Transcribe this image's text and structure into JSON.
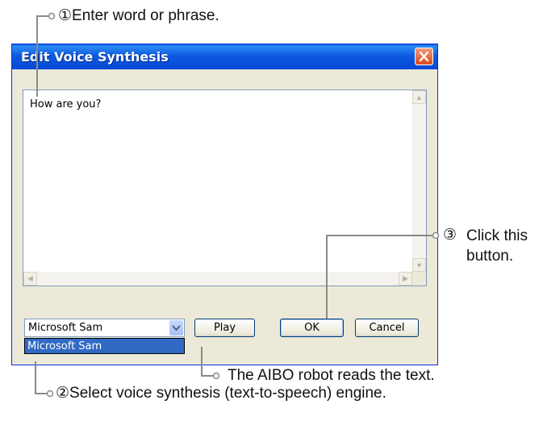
{
  "annotations": {
    "step1": "①Enter word or phrase.",
    "step2": "②Select voice synthesis (text-to-speech) engine.",
    "step3_number": "③",
    "step3_text": "Click this button.",
    "play_note": "The AIBO robot reads the text."
  },
  "dialog": {
    "title": "Edit Voice Synthesis",
    "text_value": "How are you?",
    "engine_selected": "Microsoft Sam",
    "engine_options": [
      "Microsoft Sam"
    ],
    "buttons": {
      "play": "Play",
      "ok": "OK",
      "cancel": "Cancel"
    }
  },
  "colors": {
    "titlebar": "#0a5fe4",
    "dialog_bg": "#ece9d8",
    "selection": "#316ac5",
    "close_button": "#d84a1f"
  }
}
